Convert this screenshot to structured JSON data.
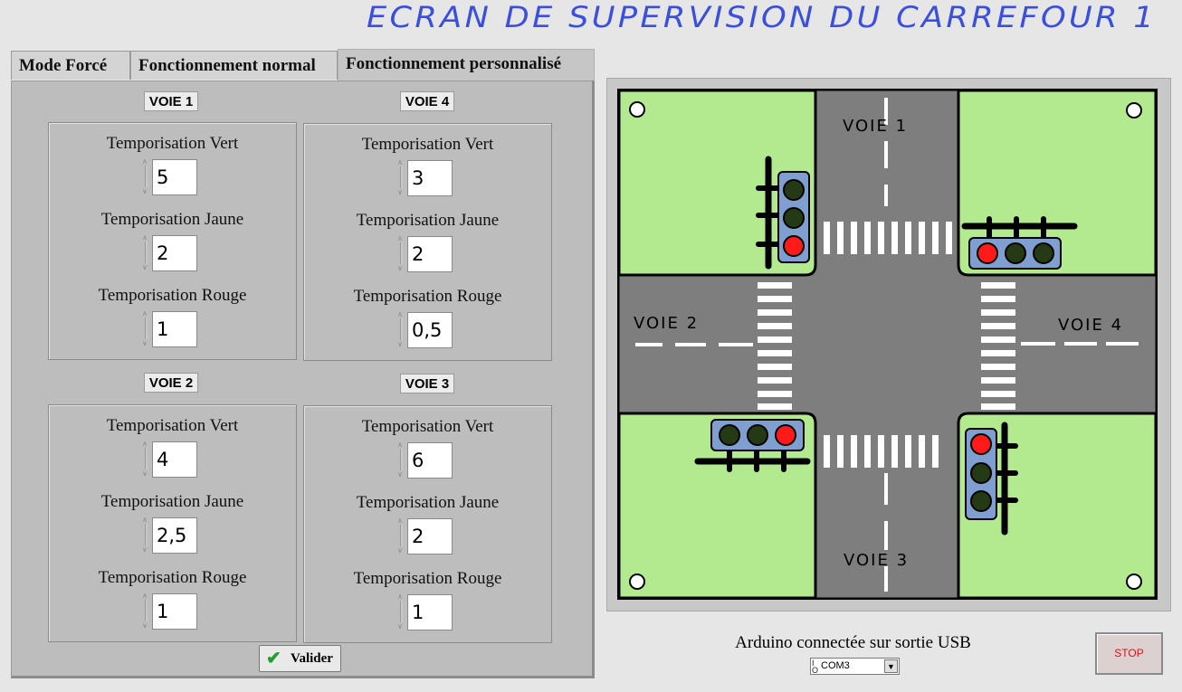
{
  "window": {
    "title": "ECRAN DE SUPERVISION DU CARREFOUR 1"
  },
  "tabs": [
    {
      "label": "Mode Forcé"
    },
    {
      "label": "Fonctionnement normal"
    },
    {
      "label": "Fonctionnement personnalisé"
    }
  ],
  "field_labels": {
    "vert": "Temporisation Vert",
    "jaune": "Temporisation Jaune",
    "rouge": "Temporisation Rouge"
  },
  "voies": [
    {
      "label": "VOIE 1",
      "vert": "5",
      "jaune": "2",
      "rouge": "1"
    },
    {
      "label": "VOIE 4",
      "vert": "3",
      "jaune": "2",
      "rouge": "0,5"
    },
    {
      "label": "VOIE 2",
      "vert": "4",
      "jaune": "2,5",
      "rouge": "1"
    },
    {
      "label": "VOIE 3",
      "vert": "6",
      "jaune": "2",
      "rouge": "1"
    }
  ],
  "valider_label": "Valider",
  "map": {
    "road_labels": [
      "VOIE 1",
      "VOIE 2",
      "VOIE 3",
      "VOIE 4"
    ],
    "colors": {
      "grass": "#b3ea8f",
      "road": "#7e7e7e",
      "light_housing": "#7f9fd0",
      "red_on": "#ff1a1a",
      "green_off": "#243a14"
    },
    "lights": [
      {
        "position": "voie-1",
        "active": "red"
      },
      {
        "position": "voie-4",
        "active": "red"
      },
      {
        "position": "voie-2",
        "active": "red"
      },
      {
        "position": "voie-3",
        "active": "red"
      }
    ]
  },
  "status": {
    "text": "Arduino connectée sur sortie USB",
    "port": "COM3",
    "io_label": "I/O"
  },
  "stop_label": "STOP"
}
